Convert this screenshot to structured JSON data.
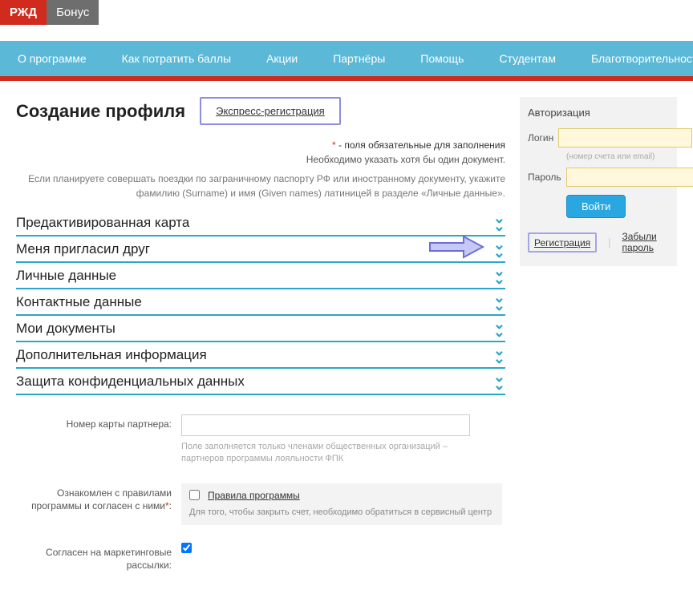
{
  "logo": {
    "rzd": "РЖД",
    "bonus": "Бонус"
  },
  "nav": [
    "О программе",
    "Как потратить баллы",
    "Акции",
    "Партнёры",
    "Помощь",
    "Студентам",
    "Благотворительность"
  ],
  "page_title": "Создание профиля",
  "express_link": "Экспресс-регистрация",
  "required_note": "- поля обязательные для заполнения",
  "doc_note": "Необходимо указать хотя бы один документ.",
  "passport_note": "Если планируете совершать поездки по заграничному паспорту РФ или иностранному документу, укажите фамилию (Surname) и имя (Given names) латиницей в разделе «Личные данные».",
  "accordion": [
    "Предактивированная карта",
    "Меня пригласил друг",
    "Личные данные",
    "Контактные данные",
    "Мои документы",
    "Дополнительная информация",
    "Защита конфиденциальных данных"
  ],
  "partner_card": {
    "label": "Номер карты партнера:",
    "value": "",
    "hint": "Поле заполняется только членами общественных организаций – партнеров программы лояльности ФПК"
  },
  "agree_rules": {
    "label_line1": "Ознакомлен с правилами",
    "label_line2": "программы и согласен с ними",
    "link": "Правила программы",
    "hint": "Для того, чтобы закрыть счет, необходимо обратиться в сервисный центр"
  },
  "marketing": {
    "label_line1": "Согласен на маркетинговые",
    "label_line2": "рассылки:"
  },
  "sidebar": {
    "title": "Авторизация",
    "login_label": "Логин",
    "login_hint": "(номер счета или email)",
    "password_label": "Пароль",
    "login_btn": "Войти",
    "register_link": "Регистрация",
    "forgot_link": "Забыли пароль"
  }
}
